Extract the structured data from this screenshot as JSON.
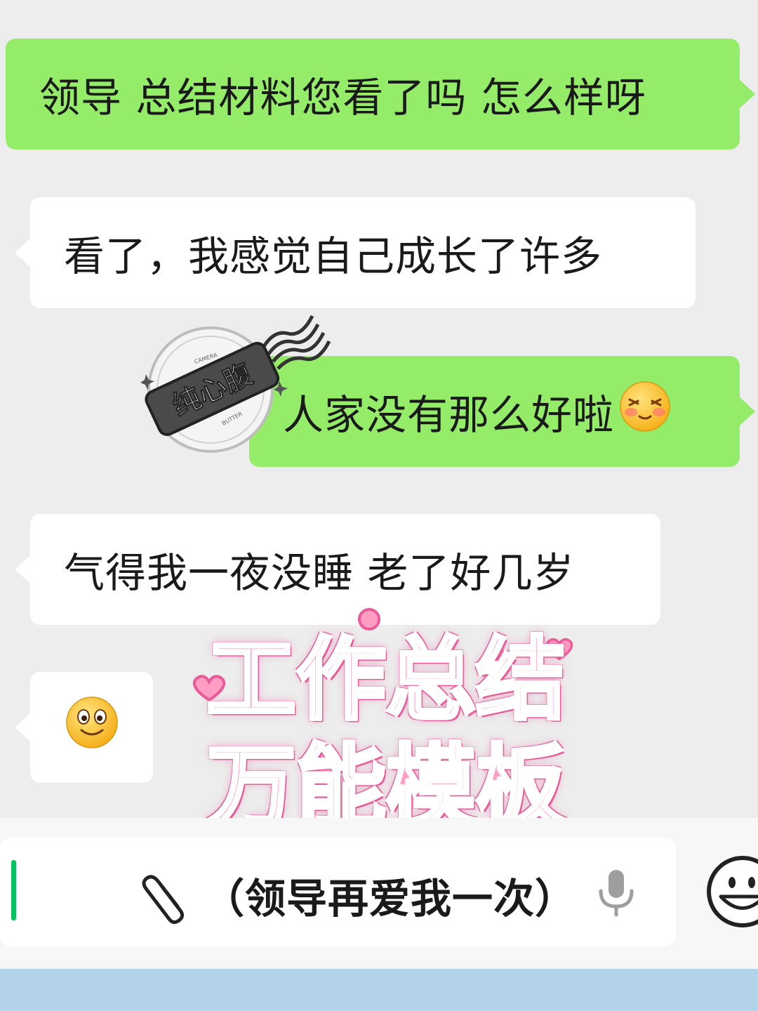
{
  "messages": [
    {
      "direction": "out",
      "text": "领导 总结材料您看了吗 怎么样呀"
    },
    {
      "direction": "in",
      "text": "看了，我感觉自己成长了许多"
    },
    {
      "direction": "out",
      "text": "人家没有那么好啦",
      "emoji": "shy-blush-emoji"
    },
    {
      "direction": "in",
      "text": "气得我一夜没睡 老了好几岁"
    },
    {
      "direction": "in",
      "emoji": "smile-emoji"
    }
  ],
  "sticker": {
    "label": "纯心腹",
    "ring_top": "CAMERA",
    "ring_bottom": "BUTTER"
  },
  "overlay": {
    "line1": "工作总结",
    "line2": "万能模板",
    "color": "#ff9dc3",
    "outline": "#e95b98"
  },
  "input_bar": {
    "text": "（领导再爱我一次）",
    "icons": [
      "paperclip-icon",
      "microphone-icon",
      "emoji-icon"
    ]
  },
  "colors": {
    "chat_background": "#ededed",
    "outgoing_bubble": "#95ec69",
    "incoming_bubble": "#ffffff",
    "caret": "#07c160"
  }
}
